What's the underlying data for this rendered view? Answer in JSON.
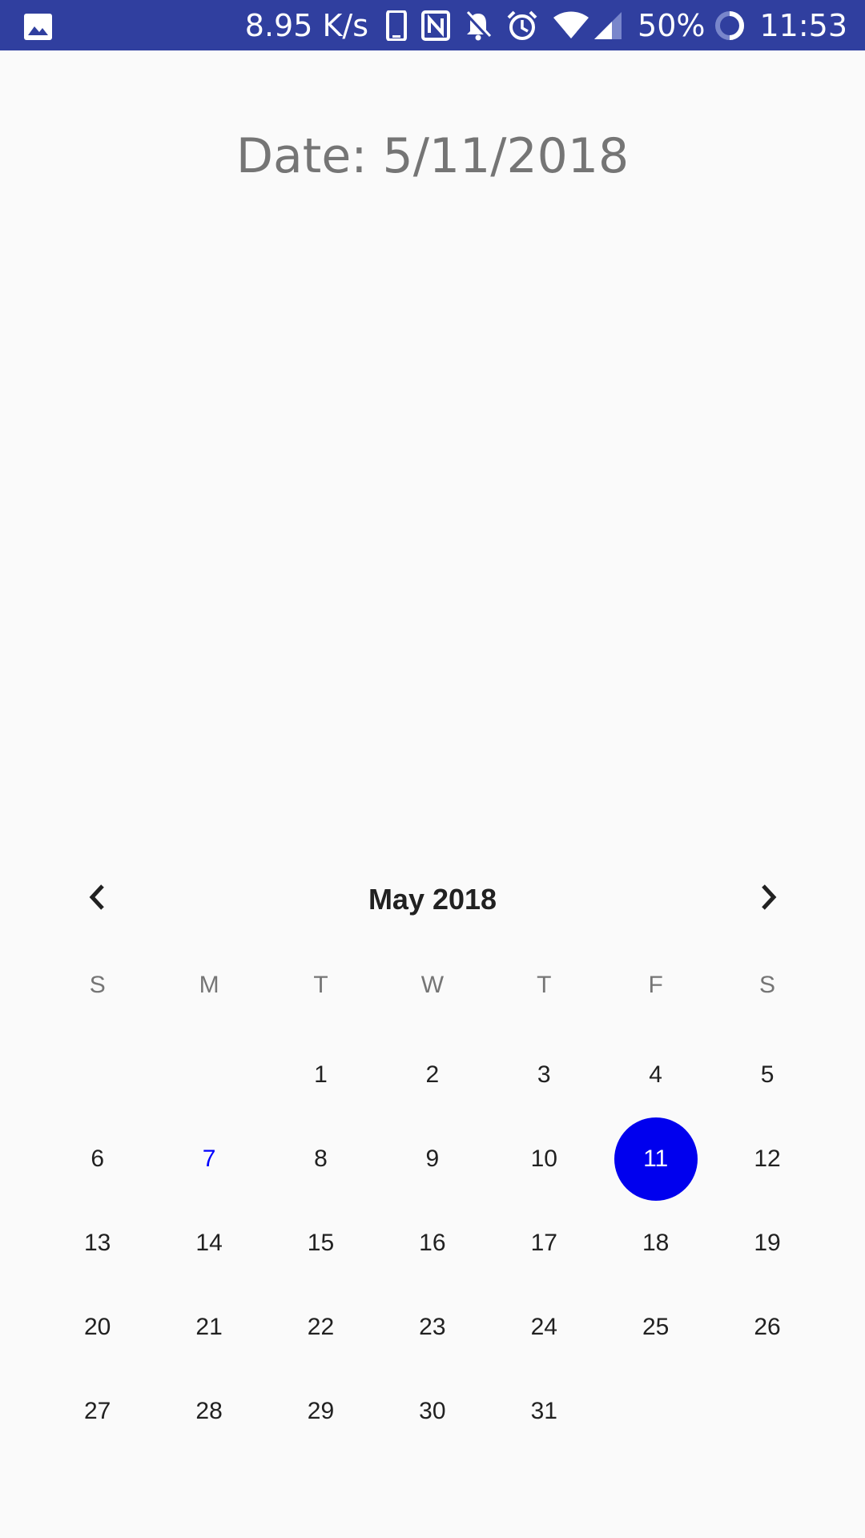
{
  "status_bar": {
    "network_speed": "8.95 K/s",
    "battery_percent": "50%",
    "time": "11:53",
    "background_color": "#303f9f",
    "icons": [
      "image-icon",
      "phone-icon",
      "nfc-icon",
      "notifications-off-icon",
      "alarm-icon",
      "wifi-icon",
      "cell-signal-icon",
      "battery-icon"
    ]
  },
  "header": {
    "date_label": "Date: 5/11/2018"
  },
  "calendar": {
    "month_title": "May 2018",
    "prev_icon": "chevron-left-icon",
    "next_icon": "chevron-right-icon",
    "weekdays": [
      "S",
      "M",
      "T",
      "W",
      "T",
      "F",
      "S"
    ],
    "leading_empty_days": 2,
    "days": [
      "1",
      "2",
      "3",
      "4",
      "5",
      "6",
      "7",
      "8",
      "9",
      "10",
      "11",
      "12",
      "13",
      "14",
      "15",
      "16",
      "17",
      "18",
      "19",
      "20",
      "21",
      "22",
      "23",
      "24",
      "25",
      "26",
      "27",
      "28",
      "29",
      "30",
      "31"
    ],
    "today": "7",
    "selected": "11",
    "selected_color": "#0000ee",
    "today_color": "#0000ff"
  }
}
